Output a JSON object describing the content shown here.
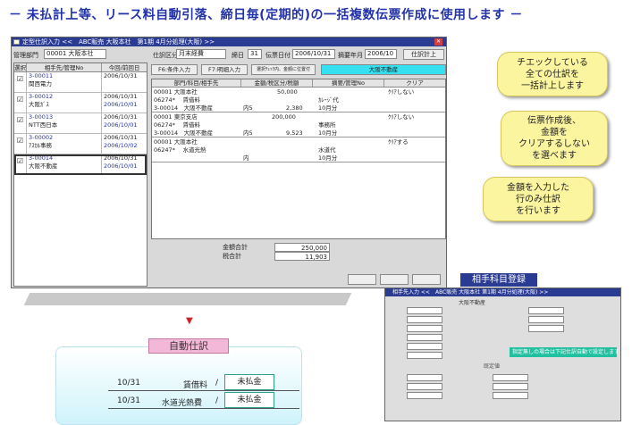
{
  "header": {
    "text": "－ 未払計上等、リース料自動引落、締日毎(定期的)の一括複数伝票作成に使用します －"
  },
  "window": {
    "title": "定型仕訳入力 <<　ABC販売 大阪本社　第1期 4月分処理(大阪) >>",
    "row": {
      "dept_label": "管理部門",
      "dept_value": "00001 大阪本社",
      "date_label": "締日",
      "date_value": "31",
      "slip_date_label": "伝票日付",
      "slip_date_value": "2006/10/31",
      "year_label": "摘要年月",
      "year_value": "2006/10",
      "post_button": "仕訳計上"
    },
    "class_label": "仕訳区分",
    "class_value": "月末経費",
    "left": {
      "headers": [
        "選択",
        "相手先/管理No",
        "今回/前回日"
      ],
      "rows": [
        {
          "check": "☑",
          "code": "3-00011",
          "name": "関西電力",
          "d1": "2006/10/31",
          "d2": ""
        },
        {
          "check": "☑",
          "code": "3-00012",
          "name": "大阪ｶﾞｽ",
          "d1": "2006/10/31",
          "d2": "2006/10/01"
        },
        {
          "check": "☑",
          "code": "3-00013",
          "name": "NTT西日本",
          "d1": "2006/10/31",
          "d2": "2006/10/01"
        },
        {
          "check": "☑",
          "code": "3-00002",
          "name": "ｱｽｶﾙ事務",
          "d1": "2006/10/31",
          "d2": "2006/10/02"
        },
        {
          "check": "☑",
          "code": "3-00014",
          "name": "大阪不動産",
          "d1": "2006/10/31",
          "d2": "2006/10/01"
        }
      ]
    },
    "toolbar": {
      "f6": "F6:条件入力",
      "f7": "F7:明細入力",
      "sel": "選択ﾁｪｯｸ内、金額に位置付",
      "name": "大阪不動産"
    },
    "grid": {
      "headers": [
        "部門/科目/相手先",
        "金額/税区分/税額",
        "摘要/管理No",
        "クリア"
      ],
      "entries": [
        {
          "a1": "00001 大阪本社",
          "a2": "06274* 　賃借料",
          "a3": "3-00014　大阪不動産",
          "b1": "50,000",
          "b2": "内5",
          "b3": "2,380",
          "c1": "ｶﾚｰｼﾞ代",
          "c2": "10月分",
          "d": "ｸﾘｱしない"
        },
        {
          "a1": "00001 東京支店",
          "a2": "06274* 　賃借料",
          "a3": "3-00014　大阪不動産",
          "b1": "200,000",
          "b2": "内5",
          "b3": "9,523",
          "c1": "事務所",
          "c2": "10月分",
          "d": "ｸﾘｱしない"
        },
        {
          "a1": "00001 大阪本社",
          "a2": "06247* 　水道光熱",
          "a3": "",
          "b1": "",
          "b2": "内",
          "b3": "",
          "c1": "水道代",
          "c2": "10月分",
          "d": "ｸﾘｱする"
        }
      ]
    },
    "totals": {
      "amount_label": "金額合計",
      "amount": "250,000",
      "tax_label": "税合計",
      "tax": "11,903"
    }
  },
  "callouts": {
    "c1": "チエックしている\n全ての仕訳を\n一括計上します",
    "c2": "伝票作成後、\n金額を\nクリアするしない\nを選べます",
    "c3": "金額を入力した\n行のみ仕訳\nを行います"
  },
  "auto": {
    "label": "自動仕訳",
    "r1": {
      "date": "10/31",
      "acct": "賃借料",
      "slash": "/",
      "box": "未払金"
    },
    "r2": {
      "date": "10/31",
      "acct": "水道光熱費",
      "slash": "/",
      "box": "未払金"
    }
  },
  "sub": {
    "title": "相手科目登録",
    "win_title": "相手先入力 <<　ABC販売 大阪本社 第1期 4月分処理(大阪) >>",
    "name": "大阪不動産",
    "green": "指定無しの場合は下記仕訳自動で設定します",
    "section": "既定値"
  },
  "colors": {
    "accent": "#2a3b94",
    "callout": "#fbf5a0",
    "highlight": "#35e0f0"
  }
}
